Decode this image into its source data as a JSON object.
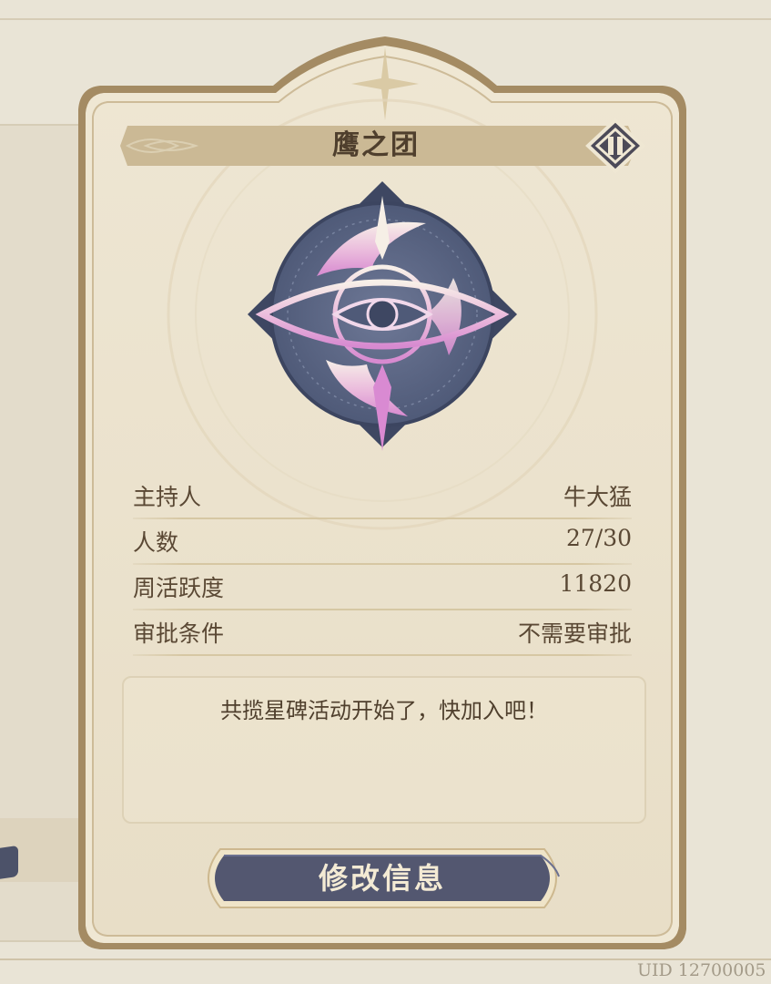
{
  "guild": {
    "name": "鹰之团",
    "info_rows": [
      {
        "label": "主持人",
        "value": "牛大猛"
      },
      {
        "label": "人数",
        "value": "27/30"
      },
      {
        "label": "周活跃度",
        "value": "11820"
      },
      {
        "label": "审批条件",
        "value": "不需要审批"
      }
    ],
    "announcement": "共揽星碑活动开始了，快加入吧！"
  },
  "buttons": {
    "edit_label": "修改信息"
  },
  "footer": {
    "uid_text": "UID 12700005"
  },
  "colors": {
    "card_border": "#a48b63",
    "card_fill": "#ece3cf",
    "title_bar": "#cbb995",
    "button_fill": "#535770",
    "emblem_ring": "#56627f",
    "emblem_glow": "#e6a8d9"
  },
  "icons": {
    "swap": "swap-diamond-icon",
    "emblem": "guild-eye-emblem"
  }
}
